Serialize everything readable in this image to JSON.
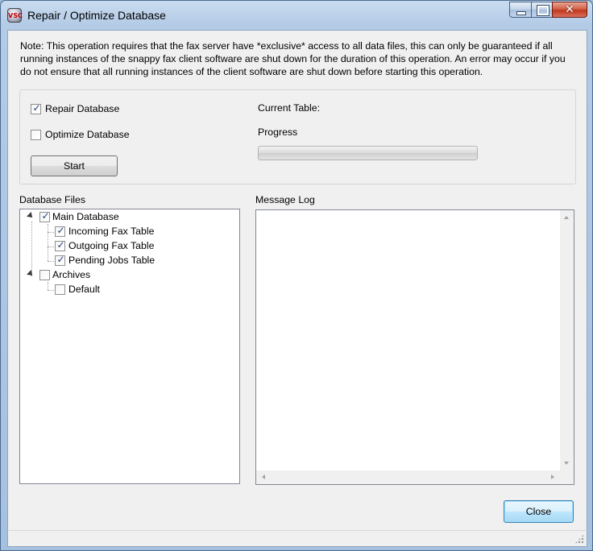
{
  "window": {
    "title": "Repair / Optimize Database",
    "app_icon": "fax-app-icon",
    "buttons": {
      "minimize": "minimize-icon",
      "maximize": "maximize-icon",
      "close": "✕"
    }
  },
  "note": "Note: This operation requires that the fax server have *exclusive* access to all data files, this can only be guaranteed if all running instances of the snappy fax client software are shut down for the duration of this operation.  An error may occur if you do not ensure that all running instances of the client software are shut down before starting this operation.",
  "options": {
    "repair": {
      "label": "Repair Database",
      "checked": true
    },
    "optimize": {
      "label": "Optimize Database",
      "checked": false
    },
    "start_label": "Start",
    "current_table_label": "Current Table:",
    "current_table_value": "",
    "progress_label": "Progress",
    "progress_value": 0
  },
  "database_files": {
    "label": "Database Files",
    "tree": [
      {
        "label": "Main Database",
        "checked": true,
        "expanded": true,
        "children": [
          {
            "label": "Incoming Fax Table",
            "checked": true
          },
          {
            "label": "Outgoing Fax Table",
            "checked": true
          },
          {
            "label": "Pending Jobs Table",
            "checked": true
          }
        ]
      },
      {
        "label": "Archives",
        "checked": false,
        "expanded": true,
        "children": [
          {
            "label": "Default",
            "checked": false
          }
        ]
      }
    ]
  },
  "message_log": {
    "label": "Message Log",
    "content": ""
  },
  "footer": {
    "close_label": "Close"
  },
  "check_glyph": "✓"
}
